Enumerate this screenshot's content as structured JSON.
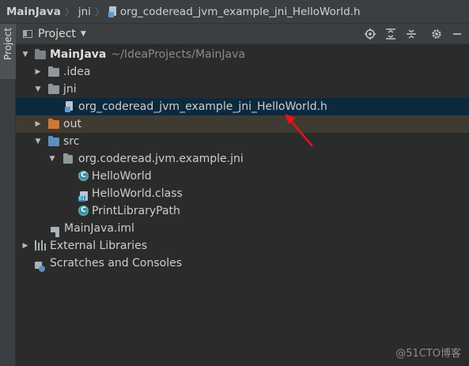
{
  "breadcrumb": {
    "root": "MainJava",
    "folder": "jni",
    "file": "org_coderead_jvm_example_jni_HelloWorld.h",
    "icons": {
      "file": "c-header-file-icon"
    }
  },
  "stripe": {
    "tab_label": "Project"
  },
  "panel": {
    "title": "Project",
    "tool_icons": [
      "locate-icon",
      "expand-all-icon",
      "collapse-all-icon",
      "gear-icon",
      "minimize-icon"
    ]
  },
  "tree": {
    "project": {
      "name": "MainJava",
      "path": "~/IdeaProjects/MainJava"
    },
    "idea": ".idea",
    "jni": "jni",
    "header_file": "org_coderead_jvm_example_jni_HelloWorld.h",
    "out": "out",
    "src": "src",
    "package": "org.coderead.jvm.example.jni",
    "helloworld": "HelloWorld",
    "helloworld_class": "HelloWorld.class",
    "printlibrarypath": "PrintLibraryPath",
    "iml": "MainJava.iml",
    "external_libraries": "External Libraries",
    "scratches": "Scratches and Consoles"
  },
  "colors": {
    "background": "#2b2b2b",
    "selection": "#0d293e",
    "excluded_folder_row": "#3f3b33",
    "annotation_arrow": "#e8131a"
  },
  "watermark": "@51CTO博客"
}
